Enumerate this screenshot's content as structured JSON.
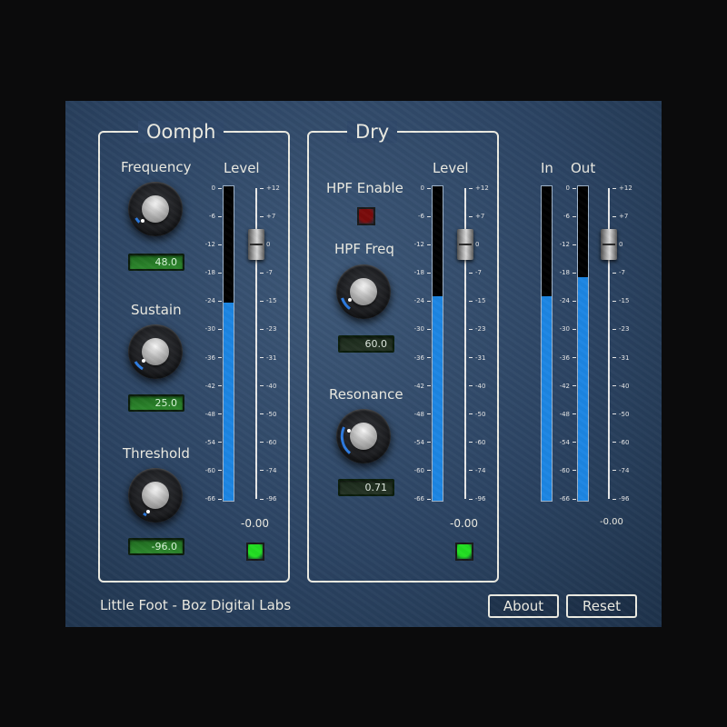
{
  "plugin": {
    "brand": "Little Foot - Boz Digital Labs",
    "about_label": "About",
    "reset_label": "Reset"
  },
  "oomph": {
    "title": "Oomph",
    "level_label": "Level",
    "level_readout": "-0.00",
    "frequency": {
      "label": "Frequency",
      "value": "48.0"
    },
    "sustain": {
      "label": "Sustain",
      "value": "25.0"
    },
    "threshold": {
      "label": "Threshold",
      "value": "-96.0"
    },
    "bypass_led_color": "#22dd22"
  },
  "dry": {
    "title": "Dry",
    "level_label": "Level",
    "level_readout": "-0.00",
    "hpf_enable_label": "HPF Enable",
    "hpf_enable_color": "#7a0b0b",
    "hpf_freq": {
      "label": "HPF Freq",
      "value": "60.0"
    },
    "resonance": {
      "label": "Resonance",
      "value": "0.71"
    },
    "bypass_led_color": "#22dd22"
  },
  "io": {
    "in_label": "In",
    "out_label": "Out",
    "level_readout": "-0.00"
  },
  "meter_scale": [
    "0",
    "-6",
    "-12",
    "-18",
    "-24",
    "-30",
    "-36",
    "-42",
    "-48",
    "-54",
    "-60",
    "-66"
  ],
  "fader_scale": [
    "+12",
    "+7",
    "0",
    "-7",
    "-15",
    "-23",
    "-31",
    "-40",
    "-50",
    "-60",
    "-74",
    "-96"
  ],
  "levels": {
    "oomph_meter_fill": 0.63,
    "dry_meter_fill": 0.65,
    "in_meter_fill": 0.65,
    "out_meter_fill": 0.71,
    "fader_position": 0.18
  },
  "colors": {
    "meter_blue": "#1d86e3",
    "panel_blue": "#2c4463",
    "frame": "#ecebe2"
  }
}
